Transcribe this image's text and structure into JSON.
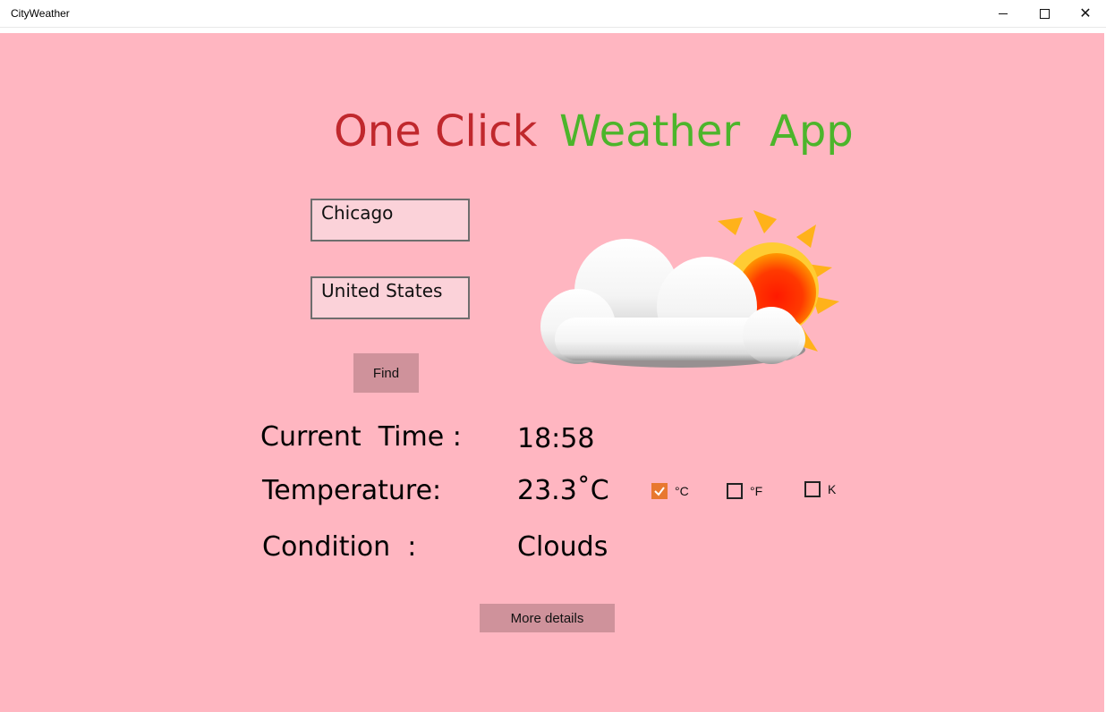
{
  "window": {
    "title": "CityWeather",
    "controls": {
      "minimize": "–",
      "maximize": "□",
      "close": "✕"
    }
  },
  "header": {
    "part1": "One Click",
    "part2": "Weather",
    "part3": "App",
    "colors": {
      "part1": "#c0282d",
      "part2": "#4cb52b",
      "part3": "#4cb52b"
    }
  },
  "inputs": {
    "city": "Chicago",
    "country": "United States"
  },
  "buttons": {
    "find": "Find",
    "more_details": "More details"
  },
  "weather_icon": "cloud-sun-icon",
  "info": {
    "time_label": "Current  Time :",
    "time_value": "18:58",
    "temp_label": "Temperature:",
    "temp_value": "23.3˚C",
    "cond_label": "Condition  :",
    "cond_value": "Clouds"
  },
  "units": [
    {
      "label": "°C",
      "checked": true
    },
    {
      "label": "°F",
      "checked": false
    },
    {
      "label": "K",
      "checked": false
    }
  ],
  "colors": {
    "background": "#ffb6c1",
    "button": "#cf929b",
    "checkbox_accent": "#e8782f"
  }
}
